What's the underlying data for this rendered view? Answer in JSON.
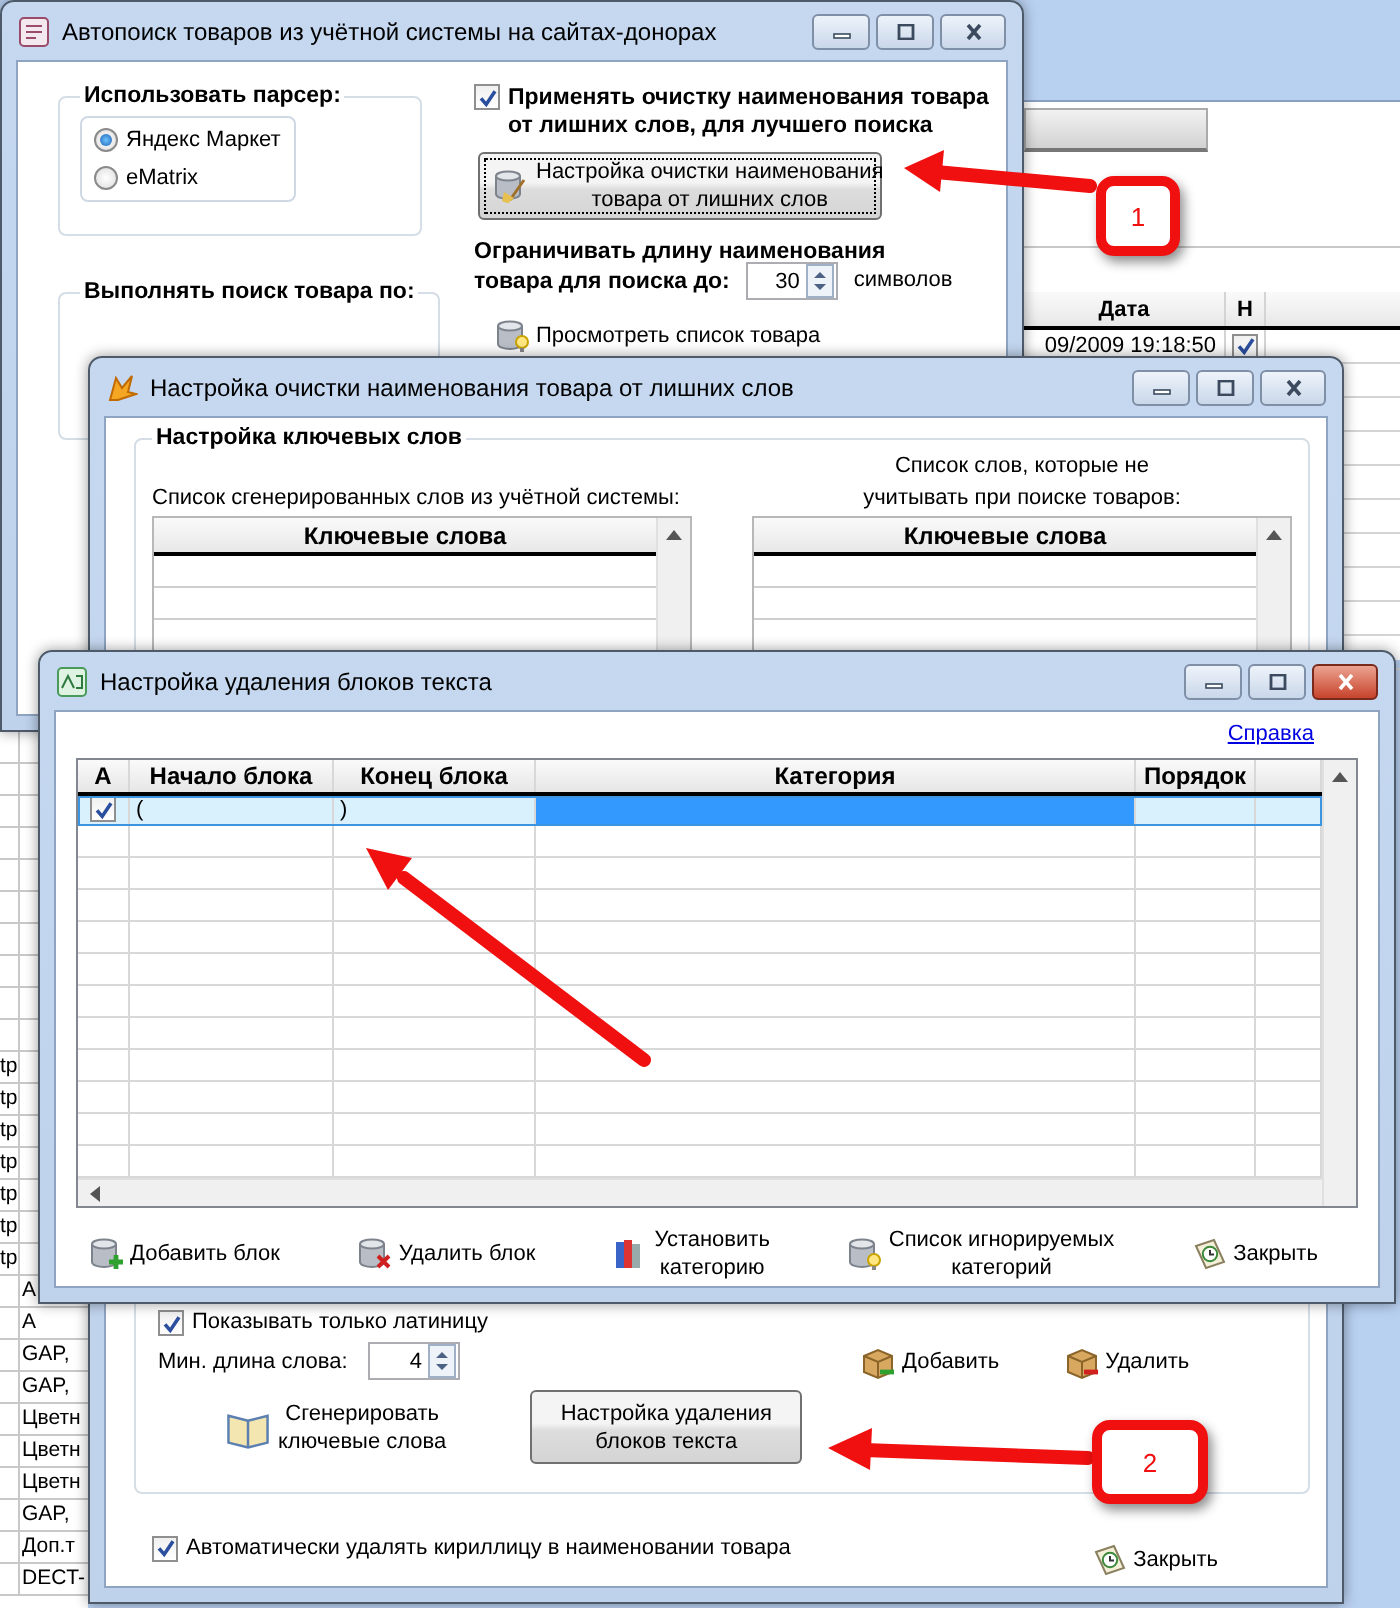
{
  "back_app": {
    "grid_columns": [
      "Дата",
      "Н"
    ],
    "grid_rows": [
      {
        "date": "09/2009 19:18:50",
        "checked": true
      }
    ],
    "left_rows": [
      {
        "kind": "first",
        "text": "tp"
      },
      {
        "kind": "first",
        "text": "tp"
      },
      {
        "kind": "first",
        "text": "tp"
      },
      {
        "kind": "first",
        "text": "tp"
      },
      {
        "kind": "first",
        "text": "tp"
      },
      {
        "kind": "first",
        "text": "tp"
      },
      {
        "kind": "first",
        "text": "tp"
      },
      {
        "kind": "second",
        "text": "А"
      },
      {
        "kind": "second",
        "text": "А"
      },
      {
        "kind": "second",
        "text": "GAP,"
      },
      {
        "kind": "second",
        "text": "GAP,"
      },
      {
        "kind": "second",
        "text": "Цветн"
      },
      {
        "kind": "second",
        "text": "Цветн"
      },
      {
        "kind": "second",
        "text": "Цветн"
      },
      {
        "kind": "second",
        "text": "GAP,"
      },
      {
        "kind": "second",
        "text": "Доп.т"
      },
      {
        "kind": "second",
        "text": "DECT-"
      }
    ]
  },
  "main_window": {
    "title": "Автопоиск товаров из учётной системы на сайтах-донорах",
    "active": false,
    "parser_group": {
      "title": "Использовать парсер:",
      "options": [
        {
          "label": "Яндекс Маркет",
          "selected": true
        },
        {
          "label": "eMatrix",
          "selected": false
        }
      ]
    },
    "search_group": {
      "title": "Выполнять поиск товара по:"
    },
    "apply_cleanup": {
      "lines": [
        "Применять очистку наименования товара",
        "от лишних слов, для лучшего поиска"
      ],
      "checked": true
    },
    "cleanup_button": [
      "Настройка очистки наименования",
      "товара от лишних слов"
    ],
    "length_limit": {
      "lines": [
        "Ограничивать длину наименования",
        "товара для поиска до:"
      ],
      "value": "30",
      "unit": "символов"
    },
    "preview_button": "Просмотреть список товара"
  },
  "cleanup_window": {
    "title": "Настройка очистки наименования товара от лишних слов",
    "active": false,
    "group_title": "Настройка ключевых слов",
    "lists": [
      {
        "caption": [
          "Список сгенерированных слов из учётной системы:"
        ],
        "column": "Ключевые слова"
      },
      {
        "caption": [
          "Список слов, которые не",
          "учитывать при поиске товаров:"
        ],
        "column": "Ключевые слова"
      }
    ],
    "latin_only": {
      "label": "Показывать только латиницу",
      "checked": true
    },
    "min_length": {
      "label": "Мин. длина слова:",
      "value": "4"
    },
    "add_button": "Добавить",
    "delete_button": "Удалить",
    "generate_button": [
      "Сгенерировать",
      "ключевые слова"
    ],
    "blocks_button": [
      "Настройка удаления",
      "блоков текста"
    ],
    "auto_remove": {
      "label": "Автоматически удалять кириллицу в наименовании товара",
      "checked": true
    },
    "close_button": "Закрыть"
  },
  "blocks_window": {
    "title": "Настройка удаления блоков текста",
    "active": true,
    "help_link": "Справка",
    "columns": [
      "А",
      "Начало блока",
      "Конец блока",
      "Категория",
      "Порядок"
    ],
    "rows": [
      {
        "active": true,
        "start": "(",
        "end": ")",
        "selected": true
      }
    ],
    "buttons": [
      {
        "kind": "add",
        "lines": [
          "Добавить блок"
        ]
      },
      {
        "kind": "remove",
        "lines": [
          "Удалить блок"
        ]
      },
      {
        "kind": "category",
        "lines": [
          "Установить",
          "категорию"
        ]
      },
      {
        "kind": "ignored",
        "lines": [
          "Список игнорируемых",
          "категорий"
        ]
      },
      {
        "kind": "close",
        "lines": [
          "Закрыть"
        ]
      }
    ]
  },
  "annotations": {
    "callouts": [
      {
        "label": "1"
      },
      {
        "label": "2"
      }
    ]
  }
}
